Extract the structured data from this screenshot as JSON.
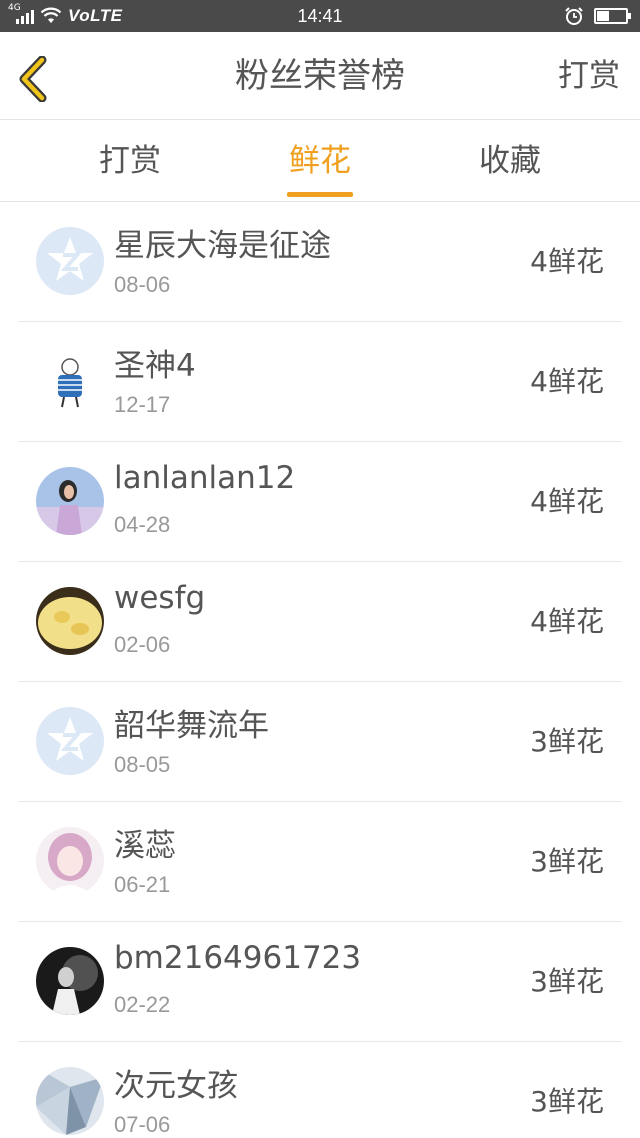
{
  "status_bar": {
    "network_label": "4G",
    "volte": "VoLTE",
    "time": "14:41",
    "battery_level_percent": 45
  },
  "header": {
    "title": "粉丝荣誉榜",
    "action_label": "打赏"
  },
  "tabs": [
    {
      "label": "打赏",
      "active": false
    },
    {
      "label": "鲜花",
      "active": true
    },
    {
      "label": "收藏",
      "active": false
    }
  ],
  "colors": {
    "accent": "#f0a01e",
    "text": "#555555",
    "subtext": "#999999",
    "status_bar": "#4a4a4a",
    "divider": "#e8e8e8"
  },
  "fans": [
    {
      "name": "星辰大海是征途",
      "date": "08-06",
      "count": "4鲜花",
      "avatar": "default-qq-avatar"
    },
    {
      "name": "圣神4",
      "date": "12-17",
      "count": "4鲜花",
      "avatar": "sketch-boy-avatar"
    },
    {
      "name": "lanlanlan12",
      "date": "04-28",
      "count": "4鲜花",
      "avatar": "girl-photo-avatar"
    },
    {
      "name": "wesfg",
      "date": "02-06",
      "count": "4鲜花",
      "avatar": "bread-photo-avatar"
    },
    {
      "name": "韶华舞流年",
      "date": "08-05",
      "count": "3鲜花",
      "avatar": "default-qq-avatar"
    },
    {
      "name": "溪蕊",
      "date": "06-21",
      "count": "3鲜花",
      "avatar": "anime-girl-avatar"
    },
    {
      "name": "bm2164961723",
      "date": "02-22",
      "count": "3鲜花",
      "avatar": "dark-photo-avatar"
    },
    {
      "name": "次元女孩",
      "date": "07-06",
      "count": "3鲜花",
      "avatar": "crystal-avatar"
    }
  ]
}
